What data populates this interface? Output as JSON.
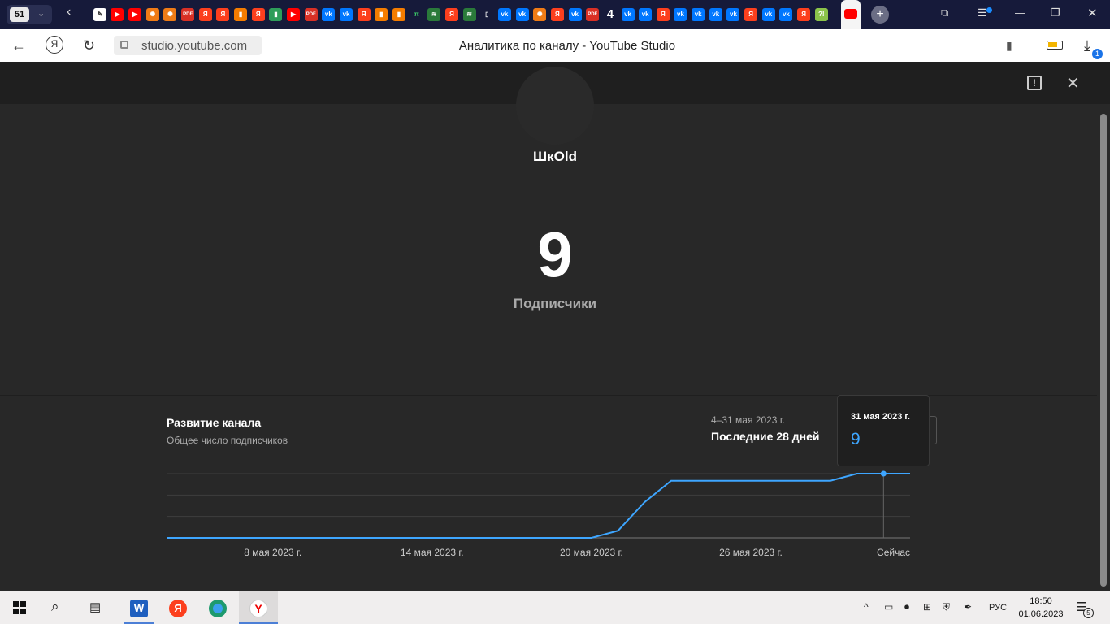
{
  "browser": {
    "tab_count": "51",
    "favicons": [
      {
        "name": "wand-icon",
        "bg": "#ffffff",
        "fg": "#333333",
        "glyph": "✎"
      },
      {
        "name": "youtube-icon",
        "bg": "#ff0000",
        "fg": "#ffffff",
        "glyph": "▶"
      },
      {
        "name": "youtube-icon",
        "bg": "#ff0000",
        "fg": "#ffffff",
        "glyph": "▶"
      },
      {
        "name": "orange-wheel-icon",
        "bg": "#f07b16",
        "fg": "#ffffff",
        "glyph": "✺"
      },
      {
        "name": "orange-wheel-icon",
        "bg": "#f07b16",
        "fg": "#ffffff",
        "glyph": "✺"
      },
      {
        "name": "pdf-icon",
        "bg": "#d93025",
        "fg": "#ffffff",
        "glyph": "PDF"
      },
      {
        "name": "yandex-icon",
        "bg": "#fc3f1d",
        "fg": "#ffffff",
        "glyph": "Я"
      },
      {
        "name": "yandex-icon",
        "bg": "#fc3f1d",
        "fg": "#ffffff",
        "glyph": "Я"
      },
      {
        "name": "book-icon",
        "bg": "#f57c00",
        "fg": "#ffffff",
        "glyph": "▮"
      },
      {
        "name": "yandex-icon",
        "bg": "#fc3f1d",
        "fg": "#ffffff",
        "glyph": "Я"
      },
      {
        "name": "book-green-icon",
        "bg": "#2e9d5a",
        "fg": "#ffffff",
        "glyph": "▮"
      },
      {
        "name": "youtube-icon",
        "bg": "#ff0000",
        "fg": "#ffffff",
        "glyph": "▶"
      },
      {
        "name": "pdf-icon",
        "bg": "#d93025",
        "fg": "#ffffff",
        "glyph": "PDF"
      },
      {
        "name": "vk-icon",
        "bg": "#0077ff",
        "fg": "#ffffff",
        "glyph": "vk"
      },
      {
        "name": "vk-icon",
        "bg": "#0077ff",
        "fg": "#ffffff",
        "glyph": "vk"
      },
      {
        "name": "yandex-icon",
        "bg": "#fc3f1d",
        "fg": "#ffffff",
        "glyph": "Я"
      },
      {
        "name": "book-icon",
        "bg": "#f57c00",
        "fg": "#ffffff",
        "glyph": "▮"
      },
      {
        "name": "book-icon",
        "bg": "#f57c00",
        "fg": "#ffffff",
        "glyph": "▮"
      },
      {
        "name": "pi-icon",
        "bg": "#161a3a",
        "fg": "#3ccf6a",
        "glyph": "π"
      },
      {
        "name": "stripes-icon",
        "bg": "#2a7a3a",
        "fg": "#ffffff",
        "glyph": "≋"
      },
      {
        "name": "yandex-icon",
        "bg": "#fc3f1d",
        "fg": "#ffffff",
        "glyph": "Я"
      },
      {
        "name": "stripes-icon",
        "bg": "#2a7a3a",
        "fg": "#ffffff",
        "glyph": "≋"
      },
      {
        "name": "document-icon",
        "bg": "#161a3a",
        "fg": "#ffffff",
        "glyph": "▯"
      },
      {
        "name": "vk-icon",
        "bg": "#0077ff",
        "fg": "#ffffff",
        "glyph": "vk"
      },
      {
        "name": "vk-icon",
        "bg": "#0077ff",
        "fg": "#ffffff",
        "glyph": "vk"
      },
      {
        "name": "orange-wheel-icon",
        "bg": "#f07b16",
        "fg": "#ffffff",
        "glyph": "✺"
      },
      {
        "name": "yandex-icon",
        "bg": "#fc3f1d",
        "fg": "#ffffff",
        "glyph": "Я"
      },
      {
        "name": "vk-icon",
        "bg": "#0077ff",
        "fg": "#ffffff",
        "glyph": "vk"
      },
      {
        "name": "pdf-icon",
        "bg": "#d93025",
        "fg": "#ffffff",
        "glyph": "PDF"
      },
      {
        "name": "four-icon",
        "bg": "#161a3a",
        "fg": "#ffffff",
        "glyph": "4"
      },
      {
        "name": "vk-icon",
        "bg": "#0077ff",
        "fg": "#ffffff",
        "glyph": "vk"
      },
      {
        "name": "vk-icon",
        "bg": "#0077ff",
        "fg": "#ffffff",
        "glyph": "vk"
      },
      {
        "name": "yandex-icon",
        "bg": "#fc3f1d",
        "fg": "#ffffff",
        "glyph": "Я"
      },
      {
        "name": "vk-icon",
        "bg": "#0077ff",
        "fg": "#ffffff",
        "glyph": "vk"
      },
      {
        "name": "vk-icon",
        "bg": "#0077ff",
        "fg": "#ffffff",
        "glyph": "vk"
      },
      {
        "name": "vk-icon",
        "bg": "#0077ff",
        "fg": "#ffffff",
        "glyph": "vk"
      },
      {
        "name": "vk-icon",
        "bg": "#0077ff",
        "fg": "#ffffff",
        "glyph": "vk"
      },
      {
        "name": "yandex-icon",
        "bg": "#fc3f1d",
        "fg": "#ffffff",
        "glyph": "Я"
      },
      {
        "name": "vk-icon",
        "bg": "#0077ff",
        "fg": "#ffffff",
        "glyph": "vk"
      },
      {
        "name": "vk-icon",
        "bg": "#0077ff",
        "fg": "#ffffff",
        "glyph": "vk"
      },
      {
        "name": "yandex-icon",
        "bg": "#fc3f1d",
        "fg": "#ffffff",
        "glyph": "Я"
      },
      {
        "name": "green-question-icon",
        "bg": "#8bc34a",
        "fg": "#ffffff",
        "glyph": "?!"
      }
    ],
    "url": "studio.youtube.com",
    "page_title": "Аналитика по каналу - YouTube Studio",
    "download_badge": "1"
  },
  "studio": {
    "channel_name": "ШкОld",
    "subscribers_count": "9",
    "subscribers_label": "Подписчики"
  },
  "growth": {
    "title": "Развитие канала",
    "subtitle": "Общее число подписчиков",
    "date_range": "4–31 мая 2023 г.",
    "period_label": "Последние 28 дней"
  },
  "tooltip": {
    "date": "31 мая 2023 г.",
    "value": "9"
  },
  "chart_data": {
    "type": "line",
    "title": "Развитие канала",
    "subtitle": "Общее число подписчиков",
    "x": [
      "4 мая 2023 г.",
      "5 мая 2023 г.",
      "6 мая 2023 г.",
      "7 мая 2023 г.",
      "8 мая 2023 г.",
      "9 мая 2023 г.",
      "10 мая 2023 г.",
      "11 мая 2023 г.",
      "12 мая 2023 г.",
      "13 мая 2023 г.",
      "14 мая 2023 г.",
      "15 мая 2023 г.",
      "16 мая 2023 г.",
      "17 мая 2023 г.",
      "18 мая 2023 г.",
      "19 мая 2023 г.",
      "20 мая 2023 г.",
      "21 мая 2023 г.",
      "22 мая 2023 г.",
      "23 мая 2023 г.",
      "24 мая 2023 г.",
      "25 мая 2023 г.",
      "26 мая 2023 г.",
      "27 мая 2023 г.",
      "28 мая 2023 г.",
      "29 мая 2023 г.",
      "30 мая 2023 г.",
      "31 мая 2023 г.",
      "1 июня 2023 г."
    ],
    "series": [
      {
        "values": [
          0,
          0,
          0,
          0,
          0,
          0,
          0,
          0,
          0,
          0,
          0,
          0,
          0,
          0,
          0,
          0,
          0,
          1,
          5,
          8,
          8,
          8,
          8,
          8,
          8,
          8,
          9,
          9,
          9
        ],
        "color": "#3ea6ff"
      }
    ],
    "x_tick_labels": [
      "8 мая 2023 г.",
      "14 мая 2023 г.",
      "20 мая 2023 г.",
      "26 мая 2023 г.",
      "Сейчас"
    ],
    "x_tick_index": [
      4,
      10,
      16,
      22,
      28
    ],
    "y_ticks": [
      0,
      3,
      6,
      9
    ],
    "ylim": [
      0,
      9
    ],
    "highlight_index": 27,
    "grid": true
  },
  "taskbar": {
    "lang": "РУС",
    "time": "18:50",
    "date": "01.06.2023",
    "notifications": "5"
  }
}
